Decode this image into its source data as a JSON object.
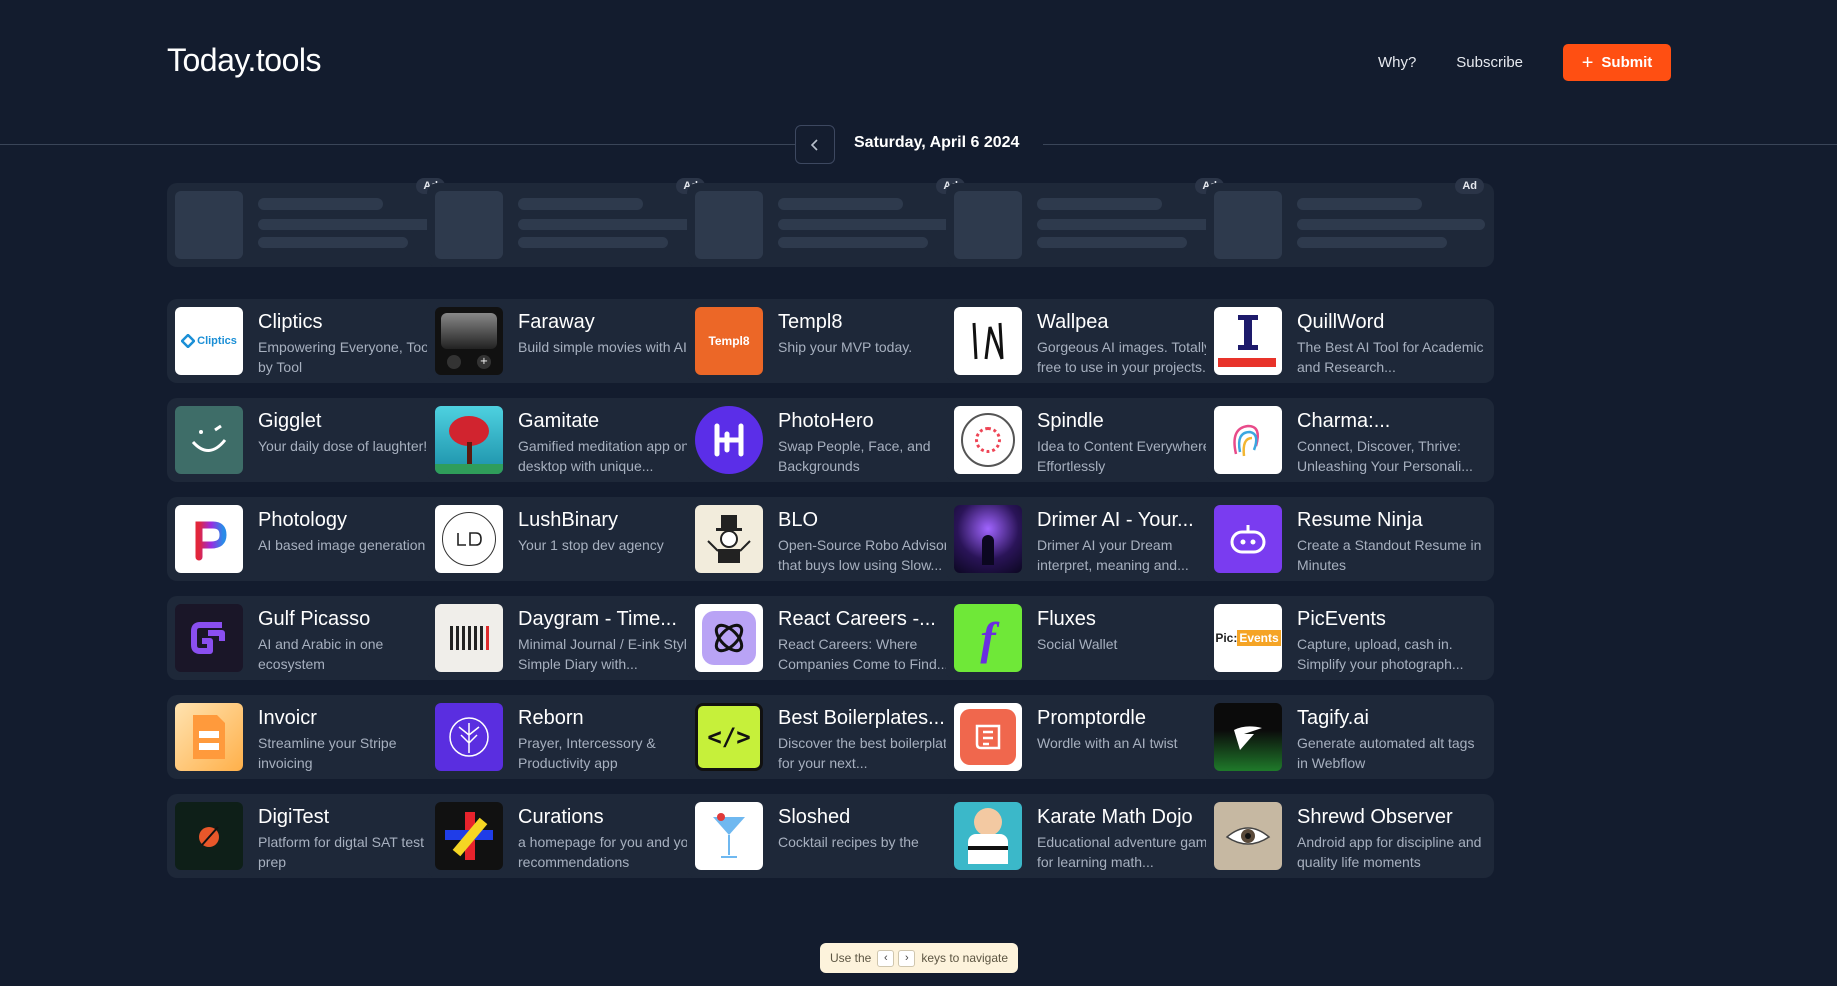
{
  "header": {
    "logo": "Today.tools",
    "nav": {
      "why": "Why?",
      "subscribe": "Subscribe",
      "submit": "Submit"
    }
  },
  "date": {
    "label": "Saturday, April 6 2024",
    "prev_icon": "chevron-left-icon"
  },
  "ads": {
    "badge": "Ad",
    "count": 5
  },
  "tools": [
    {
      "name": "Cliptics",
      "desc": "Empowering Everyone, Tool by Tool",
      "icon": "cliptics-logo"
    },
    {
      "name": "Faraway",
      "desc": "Build simple movies with AI",
      "icon": "faraway-logo"
    },
    {
      "name": "Templ8",
      "desc": "Ship your MVP today.",
      "icon": "templ8-logo"
    },
    {
      "name": "Wallpea",
      "desc": "Gorgeous AI images. Totally free to use in your projects.",
      "icon": "wallpea-logo"
    },
    {
      "name": "QuillWord",
      "desc": "The Best AI Tool for Academic and Research...",
      "icon": "quillword-logo"
    },
    {
      "name": "Gigglet",
      "desc": "Your daily dose of laughter!",
      "icon": "gigglet-logo"
    },
    {
      "name": "Gamitate",
      "desc": "Gamified meditation app on desktop with unique...",
      "icon": "gamitate-logo"
    },
    {
      "name": "PhotoHero",
      "desc": "Swap People, Face, and Backgrounds",
      "icon": "photohero-logo"
    },
    {
      "name": "Spindle",
      "desc": "Idea to Content Everywhere, Effortlessly",
      "icon": "spindle-logo"
    },
    {
      "name": "Charma:...",
      "desc": "Connect, Discover, Thrive: Unleashing Your Personali...",
      "icon": "charma-logo"
    },
    {
      "name": "Photology",
      "desc": "AI based image generation",
      "icon": "photology-logo"
    },
    {
      "name": "LushBinary",
      "desc": "Your 1 stop dev agency",
      "icon": "lushbinary-logo"
    },
    {
      "name": "BLO",
      "desc": "Open-Source Robo Advisor that buys low using Slow...",
      "icon": "blo-logo"
    },
    {
      "name": "Drimer AI - Your...",
      "desc": "Drimer AI your Dream interpret, meaning and...",
      "icon": "drimer-logo"
    },
    {
      "name": "Resume Ninja",
      "desc": "Create a Standout Resume in Minutes",
      "icon": "resume-ninja-logo"
    },
    {
      "name": "Gulf Picasso",
      "desc": "AI and Arabic in one ecosystem",
      "icon": "gulf-picasso-logo"
    },
    {
      "name": "Daygram - Time...",
      "desc": "Minimal Journal / E-ink Style Simple Diary with...",
      "icon": "daygram-logo"
    },
    {
      "name": "React Careers -...",
      "desc": "React Careers: Where Companies Come to Find...",
      "icon": "react-careers-logo"
    },
    {
      "name": "Fluxes",
      "desc": "Social Wallet",
      "icon": "fluxes-logo"
    },
    {
      "name": "PicEvents",
      "desc": "Capture, upload, cash in. Simplify your photograph...",
      "icon": "picevents-logo"
    },
    {
      "name": "Invoicr",
      "desc": "Streamline your Stripe invoicing",
      "icon": "invoicr-logo"
    },
    {
      "name": "Reborn",
      "desc": "Prayer, Intercessory & Productivity app",
      "icon": "reborn-logo"
    },
    {
      "name": "Best Boilerplates...",
      "desc": "Discover the best boilerplate for your next...",
      "icon": "boilerplates-logo"
    },
    {
      "name": "Promptordle",
      "desc": "Wordle with an AI twist",
      "icon": "promptordle-logo"
    },
    {
      "name": "Tagify.ai",
      "desc": "Generate automated alt tags in Webflow",
      "icon": "tagify-logo"
    },
    {
      "name": "DigiTest",
      "desc": "Platform for digtal SAT test prep",
      "icon": "digitest-logo"
    },
    {
      "name": "Curations",
      "desc": "a homepage for you and your recommendations",
      "icon": "curations-logo"
    },
    {
      "name": "Sloshed",
      "desc": "Cocktail recipes by the",
      "icon": "sloshed-logo"
    },
    {
      "name": "Karate Math Dojo",
      "desc": "Educational adventure game for learning math...",
      "icon": "karate-math-dojo-logo"
    },
    {
      "name": "Shrewd Observer",
      "desc": "Android app for discipline and quality life moments",
      "icon": "shrewd-observer-logo"
    }
  ],
  "hint": {
    "prefix": "Use the",
    "suffix": "keys to navigate",
    "left_key": "‹",
    "right_key": "›"
  },
  "colors": {
    "background": "#131c2e",
    "card": "#1e2839",
    "accent": "#ff4f12"
  },
  "icon_text": {
    "cliptics": "Cliptics",
    "templ8": "Templ8",
    "picevents_a": "Pic:",
    "picevents_b": "Events"
  }
}
